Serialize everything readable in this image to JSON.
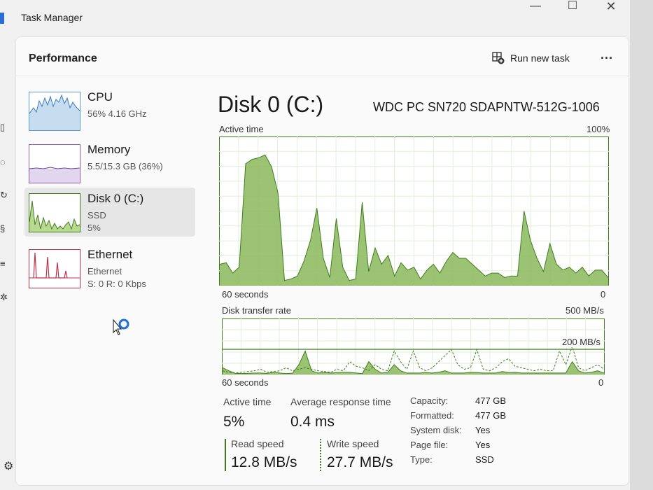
{
  "window": {
    "title": "Task Manager"
  },
  "header": {
    "section": "Performance",
    "run_new_task": "Run new task",
    "more": "..."
  },
  "devices": [
    {
      "name": "CPU",
      "line1": "56% 4.16 GHz",
      "line2": ""
    },
    {
      "name": "Memory",
      "line1": "5.5/15.3 GB (36%)",
      "line2": ""
    },
    {
      "name": "Disk 0 (C:)",
      "line1": "SSD",
      "line2": "5%"
    },
    {
      "name": "Ethernet",
      "line1": "Ethernet",
      "line2": "S: 0 R: 0 Kbps"
    }
  ],
  "detail": {
    "title": "Disk 0 (C:)",
    "model": "WDC PC SN720 SDAPNTW-512G-1006",
    "active_time_label": "Active time",
    "active_time_max": "100%",
    "seconds_label": "60 seconds",
    "zero": "0",
    "transfer_label": "Disk transfer rate",
    "transfer_max": "500 MB/s",
    "transfer_mid": "200 MB/s"
  },
  "stats": {
    "active_time": {
      "label": "Active time",
      "value": "5%"
    },
    "avg_response": {
      "label": "Average response time",
      "value": "0.4 ms"
    },
    "read_speed": {
      "label": "Read speed",
      "value": "12.8 MB/s"
    },
    "write_speed": {
      "label": "Write speed",
      "value": "27.7 MB/s"
    }
  },
  "properties": [
    {
      "label": "Capacity:",
      "value": "477 GB"
    },
    {
      "label": "Formatted:",
      "value": "477 GB"
    },
    {
      "label": "System disk:",
      "value": "Yes"
    },
    {
      "label": "Page file:",
      "value": "Yes"
    },
    {
      "label": "Type:",
      "value": "SSD"
    }
  ],
  "colors": {
    "disk_green": "#8bb85a",
    "disk_line": "#3e7d1e",
    "cpu_blue": "#5b9bd5",
    "eth_red": "#c0304a"
  },
  "chart_data": [
    {
      "type": "area",
      "title": "Active time",
      "ylabel": "%",
      "ylim": [
        0,
        100
      ],
      "x": [
        0,
        1,
        2,
        3,
        4,
        5,
        6,
        7,
        8,
        9,
        10,
        11,
        12,
        13,
        14,
        15,
        16,
        17,
        18,
        19,
        20,
        21,
        22,
        23,
        24,
        25,
        26,
        27,
        28,
        29,
        30,
        31,
        32,
        33,
        34,
        35,
        36,
        37,
        38,
        39,
        40,
        41,
        42,
        43,
        44,
        45,
        46,
        47,
        48,
        49,
        50,
        51,
        52,
        53,
        54,
        55,
        56,
        57,
        58,
        59,
        60
      ],
      "values": [
        14,
        15,
        8,
        12,
        82,
        85,
        86,
        88,
        80,
        62,
        3,
        4,
        6,
        16,
        30,
        52,
        18,
        5,
        45,
        12,
        3,
        4,
        56,
        9,
        25,
        14,
        20,
        6,
        15,
        10,
        12,
        4,
        10,
        14,
        8,
        16,
        22,
        18,
        18,
        14,
        10,
        6,
        8,
        8,
        5,
        6,
        6,
        50,
        30,
        18,
        9,
        28,
        14,
        10,
        12,
        8,
        12,
        6,
        10,
        10,
        5
      ],
      "x_labels": [
        "60 seconds",
        "0"
      ]
    },
    {
      "type": "line",
      "title": "Disk transfer rate",
      "ylabel": "MB/s",
      "ylim": [
        0,
        500
      ],
      "series": [
        {
          "name": "Read speed",
          "values": [
            40,
            20,
            3,
            2,
            3,
            5,
            5,
            3,
            10,
            5,
            2,
            4,
            60,
            150,
            20,
            5,
            10,
            5,
            8,
            10,
            10,
            5,
            2,
            80,
            30,
            5,
            10,
            60,
            20,
            5,
            5,
            5,
            8,
            5,
            10,
            20,
            5,
            5,
            5,
            10,
            8,
            5,
            5,
            5,
            15,
            8,
            10,
            5,
            5,
            5,
            5,
            5,
            5,
            5,
            5,
            80,
            20,
            5,
            10,
            20,
            5
          ]
        },
        {
          "name": "Write speed",
          "values": [
            20,
            10,
            5,
            10,
            15,
            20,
            30,
            10,
            15,
            20,
            40,
            20,
            30,
            40,
            30,
            20,
            15,
            10,
            30,
            20,
            80,
            50,
            40,
            20,
            60,
            30,
            20,
            150,
            80,
            30,
            150,
            40,
            20,
            40,
            80,
            120,
            160,
            60,
            30,
            40,
            160,
            30,
            20,
            40,
            80,
            100,
            50,
            40,
            30,
            20,
            30,
            20,
            20,
            150,
            60,
            180,
            40,
            20,
            40,
            60,
            30
          ]
        }
      ],
      "x_labels": [
        "60 seconds",
        "0"
      ]
    }
  ]
}
